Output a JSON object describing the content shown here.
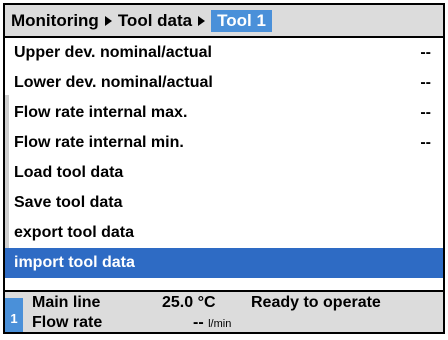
{
  "header": {
    "crumbs": [
      "Monitoring",
      "Tool data"
    ],
    "active": "Tool 1"
  },
  "menu": {
    "items": [
      {
        "label": "Upper dev. nominal/actual",
        "value": "--"
      },
      {
        "label": "Lower dev. nominal/actual",
        "value": "--"
      },
      {
        "label": "Flow rate internal max.",
        "value": "--"
      },
      {
        "label": "Flow rate internal min.",
        "value": "--"
      },
      {
        "label": "Load tool data",
        "value": ""
      },
      {
        "label": "Save tool data",
        "value": ""
      },
      {
        "label": "export tool data",
        "value": ""
      },
      {
        "label": "import tool data",
        "value": ""
      }
    ],
    "selected_index": 7
  },
  "status": {
    "channel": "1",
    "main_line_label": "Main line",
    "main_line_value": "25.0 °C",
    "flow_rate_label": "Flow rate",
    "flow_rate_value": "--",
    "flow_rate_unit": "l/min",
    "state": "Ready to operate"
  },
  "colors": {
    "selected_bg": "#2e6bc4",
    "active_crumb_bg": "#4a90d9",
    "panel_bg": "#dcdcdc"
  }
}
